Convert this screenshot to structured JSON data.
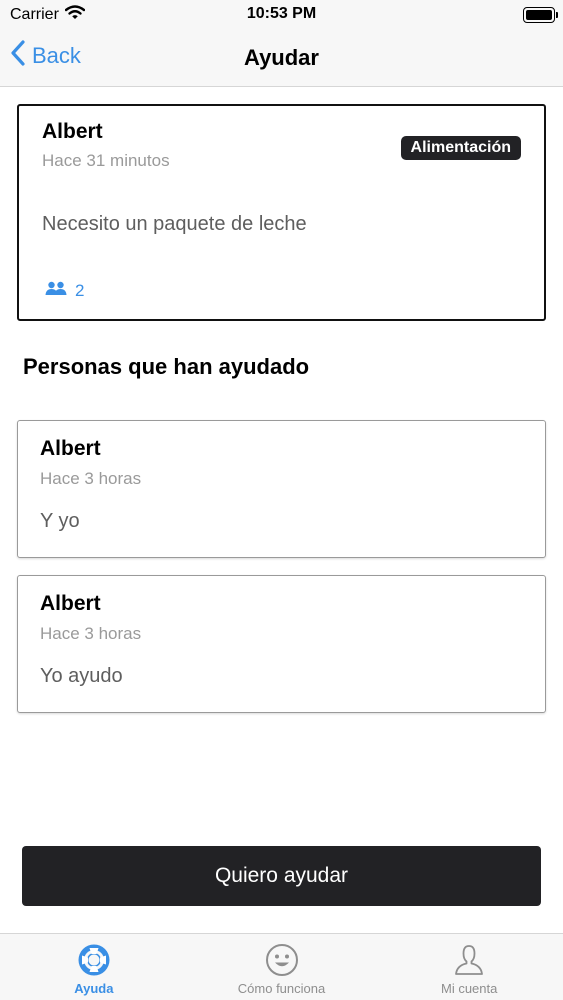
{
  "status_bar": {
    "carrier": "Carrier",
    "time": "10:53 PM",
    "battery_level": 1.0
  },
  "nav": {
    "back_label": "Back",
    "title": "Ayudar"
  },
  "request": {
    "name": "Albert",
    "time": "Hace 31 minutos",
    "category": "Alimentación",
    "message": "Necesito un paquete de leche",
    "helpers_count": "2"
  },
  "section": {
    "title": "Personas que han ayudado"
  },
  "helpers": [
    {
      "name": "Albert",
      "time": "Hace 3 horas",
      "message": "Y yo"
    },
    {
      "name": "Albert",
      "time": "Hace 3 horas",
      "message": "Yo ayudo"
    }
  ],
  "actions": {
    "help_label": "Quiero ayudar"
  },
  "tabs": [
    {
      "label": "Ayuda",
      "icon": "lifebuoy-icon",
      "active": true
    },
    {
      "label": "Cómo funciona",
      "icon": "smiley-icon",
      "active": false
    },
    {
      "label": "Mi cuenta",
      "icon": "person-icon",
      "active": false
    }
  ],
  "colors": {
    "accent": "#3a8fe5",
    "dark": "#222225",
    "muted": "#9a9a9a"
  }
}
